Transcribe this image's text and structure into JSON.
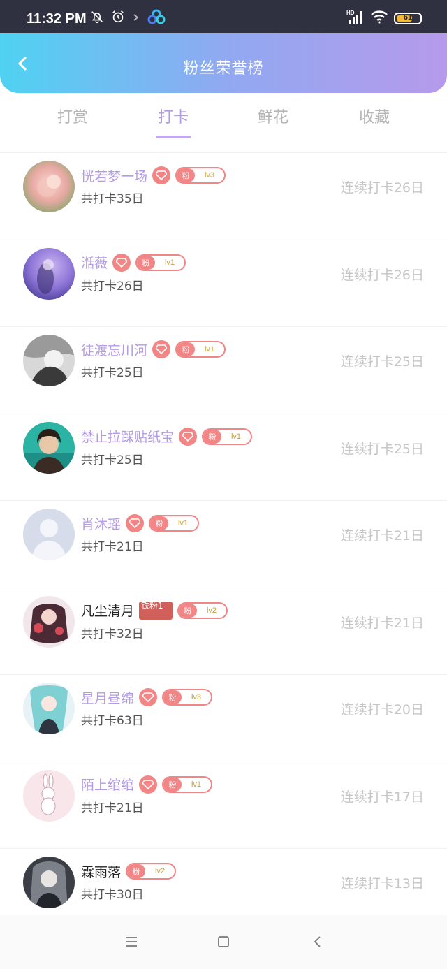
{
  "status": {
    "time": "11:32 PM",
    "battery": "61",
    "network": "HD"
  },
  "header": {
    "title": "粉丝荣誉榜"
  },
  "tabs": [
    {
      "label": "打赏",
      "active": false
    },
    {
      "label": "打卡",
      "active": true
    },
    {
      "label": "鲜花",
      "active": false
    },
    {
      "label": "收藏",
      "active": false
    }
  ],
  "colors": {
    "accent": "#b39ae6",
    "badge": "#f28585",
    "iron_badge": "#d2605a",
    "header_start": "#4fd2f2",
    "header_end": "#b69aeb"
  },
  "entries": [
    {
      "name": "恍若梦一场",
      "level": "lv3",
      "fan_label": "粉",
      "total": "共打卡35日",
      "streak": "连续打卡26日"
    },
    {
      "name": "湉薇",
      "level": "lv1",
      "fan_label": "粉",
      "total": "共打卡26日",
      "streak": "连续打卡26日"
    },
    {
      "name": "徒渡忘川河",
      "level": "lv1",
      "fan_label": "粉",
      "total": "共打卡25日",
      "streak": "连续打卡25日"
    },
    {
      "name": "禁止拉踩贴纸宝",
      "level": "lv1",
      "fan_label": "粉",
      "total": "共打卡25日",
      "streak": "连续打卡25日"
    },
    {
      "name": "肖沐瑶",
      "level": "lv1",
      "fan_label": "粉",
      "total": "共打卡21日",
      "streak": "连续打卡21日"
    },
    {
      "name": "凡尘清月",
      "level": "lv2",
      "fan_label": "粉",
      "iron_label": "铁粉1",
      "total": "共打卡32日",
      "streak": "连续打卡21日"
    },
    {
      "name": "星月昼绵",
      "level": "lv3",
      "fan_label": "粉",
      "total": "共打卡63日",
      "streak": "连续打卡20日"
    },
    {
      "name": "陌上绾绾",
      "level": "lv1",
      "fan_label": "粉",
      "total": "共打卡21日",
      "streak": "连续打卡17日"
    },
    {
      "name": "霖雨落",
      "level": "lv2",
      "fan_label": "粉",
      "total": "共打卡30日",
      "streak": "连续打卡13日"
    }
  ],
  "icons": {
    "back": "chevron-left-icon",
    "diamond": "diamond-icon",
    "nav_menu": "menu-icon",
    "nav_home": "square-icon",
    "nav_back": "triangle-back-icon"
  }
}
